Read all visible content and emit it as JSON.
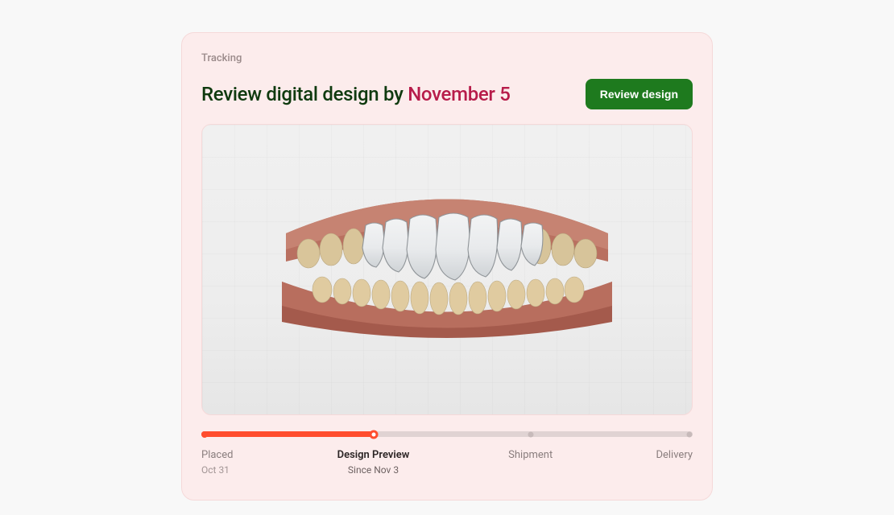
{
  "card": {
    "section_label": "Tracking",
    "title_prefix": "Review digital design by ",
    "title_deadline": "November 5",
    "button_label": "Review design"
  },
  "timeline": {
    "progress_percent": 35,
    "stages": [
      {
        "name": "Placed",
        "date": "Oct 31",
        "state": "done",
        "pos": 0
      },
      {
        "name": "Design Preview",
        "date": "Since Nov 3",
        "state": "current",
        "pos": 35
      },
      {
        "name": "Shipment",
        "date": "",
        "state": "future",
        "pos": 67
      },
      {
        "name": "Delivery",
        "date": "",
        "state": "future",
        "pos": 100
      }
    ]
  }
}
